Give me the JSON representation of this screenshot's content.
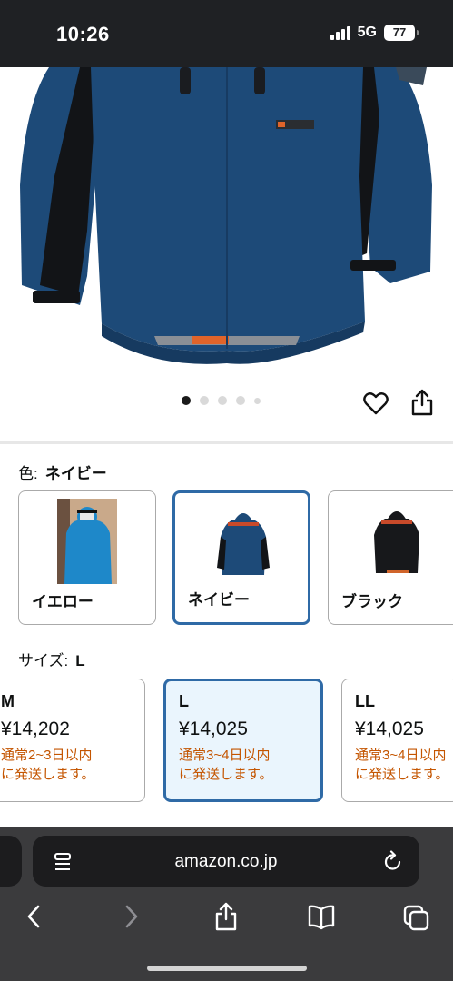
{
  "status": {
    "time": "10:26",
    "network": "5G",
    "battery": "77"
  },
  "gallery": {
    "dot_count": 5,
    "active_index": 0
  },
  "color": {
    "label": "色:",
    "selected": "ネイビー",
    "options": [
      {
        "name": "イエロー"
      },
      {
        "name": "ネイビー"
      },
      {
        "name": "ブラック"
      }
    ]
  },
  "size": {
    "label": "サイズ:",
    "selected": "L",
    "options": [
      {
        "size": "M",
        "price": "¥14,202",
        "ship1": "通常2~3日以内",
        "ship2": "に発送します。"
      },
      {
        "size": "L",
        "price": "¥14,025",
        "ship1": "通常3~4日以内",
        "ship2": "に発送します。"
      },
      {
        "size": "LL",
        "price": "¥14,025",
        "ship1": "通常3~4日以内",
        "ship2": "に発送します。"
      }
    ]
  },
  "browser": {
    "url": "amazon.co.jp"
  },
  "colors": {
    "accent": "#2f6aa6",
    "ship_text": "#c45500",
    "jacket_navy": "#1d4a78"
  }
}
